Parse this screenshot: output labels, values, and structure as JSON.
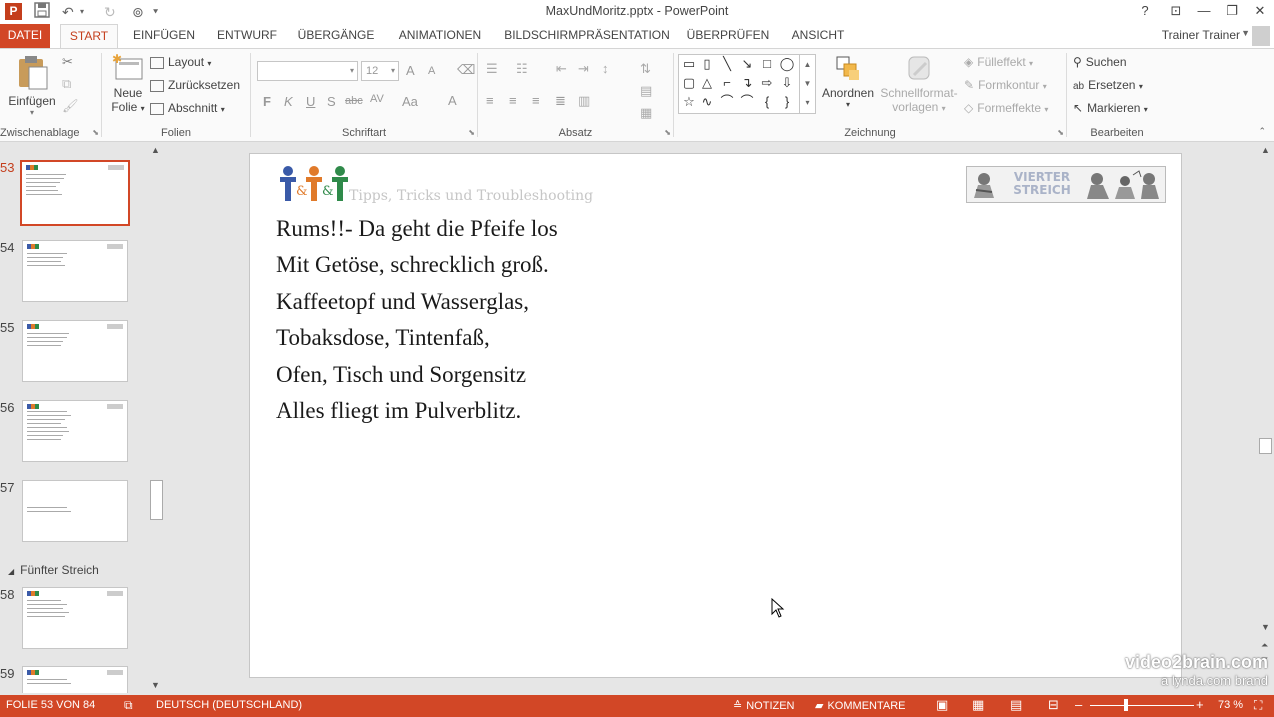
{
  "window": {
    "title": "MaxUndMoritz.pptx - PowerPoint",
    "app_icon": "P",
    "help": "?",
    "controls": {
      "restore_ribbon": "⊡",
      "minimize": "—",
      "maximize": "❐",
      "close": "✕"
    }
  },
  "tabs": [
    {
      "label": "DATEI"
    },
    {
      "label": "START"
    },
    {
      "label": "EINFÜGEN"
    },
    {
      "label": "ENTWURF"
    },
    {
      "label": "ÜBERGÄNGE"
    },
    {
      "label": "ANIMATIONEN"
    },
    {
      "label": "BILDSCHIRMPRÄSENTATION"
    },
    {
      "label": "ÜBERPRÜFEN"
    },
    {
      "label": "ANSICHT"
    }
  ],
  "user": {
    "name": "Trainer Trainer"
  },
  "ribbon": {
    "clipboard": {
      "paste": "Einfügen",
      "group": "Zwischenablage"
    },
    "slides": {
      "new_slide_1": "Neue",
      "new_slide_2": "Folie",
      "layout": "Layout",
      "reset": "Zurücksetzen",
      "section": "Abschnitt",
      "group": "Folien"
    },
    "font": {
      "font_name": "",
      "font_size": "12",
      "group": "Schriftart",
      "bold": "F",
      "italic": "K",
      "underline": "U",
      "shadow": "S",
      "strike": "abc",
      "spacing": "AV",
      "case": "Aa",
      "color": "A",
      "grow": "A",
      "shrink": "A"
    },
    "paragraph": {
      "group": "Absatz"
    },
    "drawing": {
      "arrange_1": "Anordnen",
      "quickstyles_1": "Schnellformat-",
      "quickstyles_2": "vorlagen",
      "fill": "Fülleffekt",
      "outline": "Formkontur",
      "effects": "Formeffekte",
      "group": "Zeichnung"
    },
    "editing": {
      "find": "Suchen",
      "replace": "Ersetzen",
      "select": "Markieren",
      "group": "Bearbeiten"
    }
  },
  "slide_pane": {
    "thumbnails": [
      {
        "number": "53",
        "selected": true
      },
      {
        "number": "54",
        "selected": false
      },
      {
        "number": "55",
        "selected": false
      },
      {
        "number": "56",
        "selected": false
      },
      {
        "number": "57",
        "selected": false
      },
      {
        "number": "58",
        "selected": false
      },
      {
        "number": "59",
        "selected": false
      }
    ],
    "section": "Fünfter Streich"
  },
  "slide": {
    "subtitle": "Tipps, Tricks und Troubleshooting",
    "banner_line1": "VIERTER",
    "banner_line2": "STREICH",
    "poem": [
      "Rums!!- Da geht die Pfeife los",
      "Mit Getöse, schrecklich groß.",
      "Kaffeetopf und Wasserglas,",
      "Tobaksdose, Tintenfaß,",
      "Ofen, Tisch und Sorgensitz",
      "Alles fliegt im Pulverblitz."
    ]
  },
  "watermark": {
    "line1": "video2brain.com",
    "line2": "a lynda.com brand"
  },
  "statusbar": {
    "slide_info": "FOLIE 53 VON 84",
    "language": "DEUTSCH (DEUTSCHLAND)",
    "notes": "NOTIZEN",
    "comments": "KOMMENTARE",
    "zoom": "73 %",
    "zoom_level": 0.73
  },
  "colors": {
    "accent": "#d24726",
    "accent_dark": "#c43e1c"
  }
}
